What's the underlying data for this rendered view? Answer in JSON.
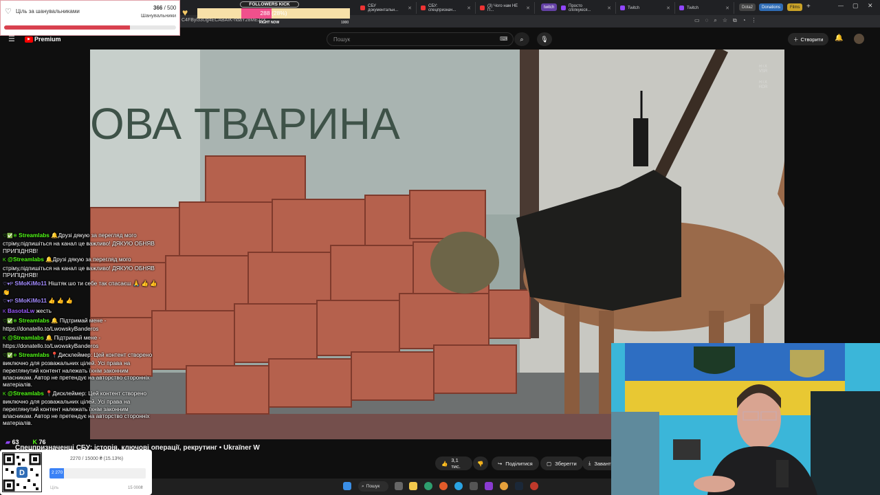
{
  "browser": {
    "tabs": [
      {
        "label": "СБУ документальн..."
      },
      {
        "label": "СБУ: спецпризнач..."
      },
      {
        "label": "(3) Чого нам НЕ П..."
      },
      {
        "label": "Просто спілкуюся..."
      },
      {
        "label": "Twitch"
      },
      {
        "label": "Twitch"
      }
    ],
    "pills": [
      "twitch",
      "Dota2",
      "Donations",
      "Films"
    ],
    "url_fragment": "C4FByl33Ug4ECABAIK-ndaY28MEJ2X..."
  },
  "youtube": {
    "logo_text": "Premium",
    "search_placeholder": "Пошук",
    "create_label": "Створити",
    "video_title": "Спецпризначенці СБУ: історія, ключові операції, рекрутинг • Ukraïner W",
    "likes": "3,1 тис.",
    "share_label": "Поділитися",
    "save_label": "Зберегти",
    "download_label": "Завант",
    "rtx_badges": [
      "RTX VSR",
      "RTX HDR"
    ]
  },
  "video_scene": {
    "wall_text": "ОВА ТВАРИНА"
  },
  "goal_widget": {
    "title": "Ціль за шанувальниками",
    "current": "366",
    "target": "500",
    "subtitle": "Шанувальники",
    "progress": 0.73
  },
  "kick_widget": {
    "title": "FOLLOWERS KICK",
    "value_text": "288 (28%)",
    "progress": 0.28,
    "left_label": "RIGHT NOW",
    "right_label": "1000"
  },
  "chat": [
    {
      "user": "Streamlabs",
      "color": "#53fc18",
      "badges": "♡✅❄",
      "text": "🔔Друзі дякую за перегляд мого стріму,підпишіться на канал це важливо! ДЯКУЮ ОБНЯВ ПРИПІДНЯВ!"
    },
    {
      "user": "@Streamlabs",
      "color": "#53fc18",
      "badges": "K",
      "text": "🔔Друзі дякую за перегляд мого стріму,підпишіться на канал це важливо! ДЯКУЮ ОБНЯВ ПРИПІДНЯВ!"
    },
    {
      "user": "SMoKiMo11",
      "color": "#a48cff",
      "badges": "♡♥P",
      "text": "Ніштяк шо ти себе так спасаєш 🙏 👍 👍 👏"
    },
    {
      "user": "SMoKiMo11",
      "color": "#a48cff",
      "badges": "♡♥P",
      "text": "👍 👍 👍"
    },
    {
      "user": "BasotaLw",
      "color": "#9b59ff",
      "badges": "K",
      "text": "жесть"
    },
    {
      "user": "Streamlabs",
      "color": "#53fc18",
      "badges": "♡✅❄",
      "text": "🔔 Підтримай мене - https://donatello.to/LwowskyBanderos"
    },
    {
      "user": "@Streamlabs",
      "color": "#53fc18",
      "badges": "K",
      "text": "🔔 Підтримай мене - https://donatello.to/LwowskyBanderos"
    },
    {
      "user": "Streamlabs",
      "color": "#53fc18",
      "badges": "♡✅❄",
      "text": "📍Дисклеймер: Цей контент створено виключно для розважальних цілей. Усі права на переглянутий контент належать їхнім законним власникам. Автор не претендує на авторство сторонніх матеріалів."
    },
    {
      "user": "@Streamlabs",
      "color": "#53fc18",
      "badges": "K",
      "text": "📍Дисклеймер: Цей контент створено виключно для розважальних цілей. Усі права на переглянутий контент належать їхнім законним власникам. Автор не претендує на авторство сторонніх матеріалів."
    }
  ],
  "viewers": {
    "twitch": "63",
    "kick": "76"
  },
  "donation_widget": {
    "summary": "2270 / 15000 ₴ (15.13%)",
    "bar_value": "2 270",
    "progress": 0.1513,
    "goal_label": "Ціль",
    "goal_amount": "15 000₴"
  },
  "taskbar": {
    "search_label": "Пошук"
  },
  "colors": {
    "youtube_red": "#ff0000",
    "twitch_purple": "#9146ff",
    "kick_green": "#53fc18",
    "goal_bar": "#d8414f",
    "kick_bar": "#f0508c",
    "donation_blue": "#3b82f6"
  }
}
